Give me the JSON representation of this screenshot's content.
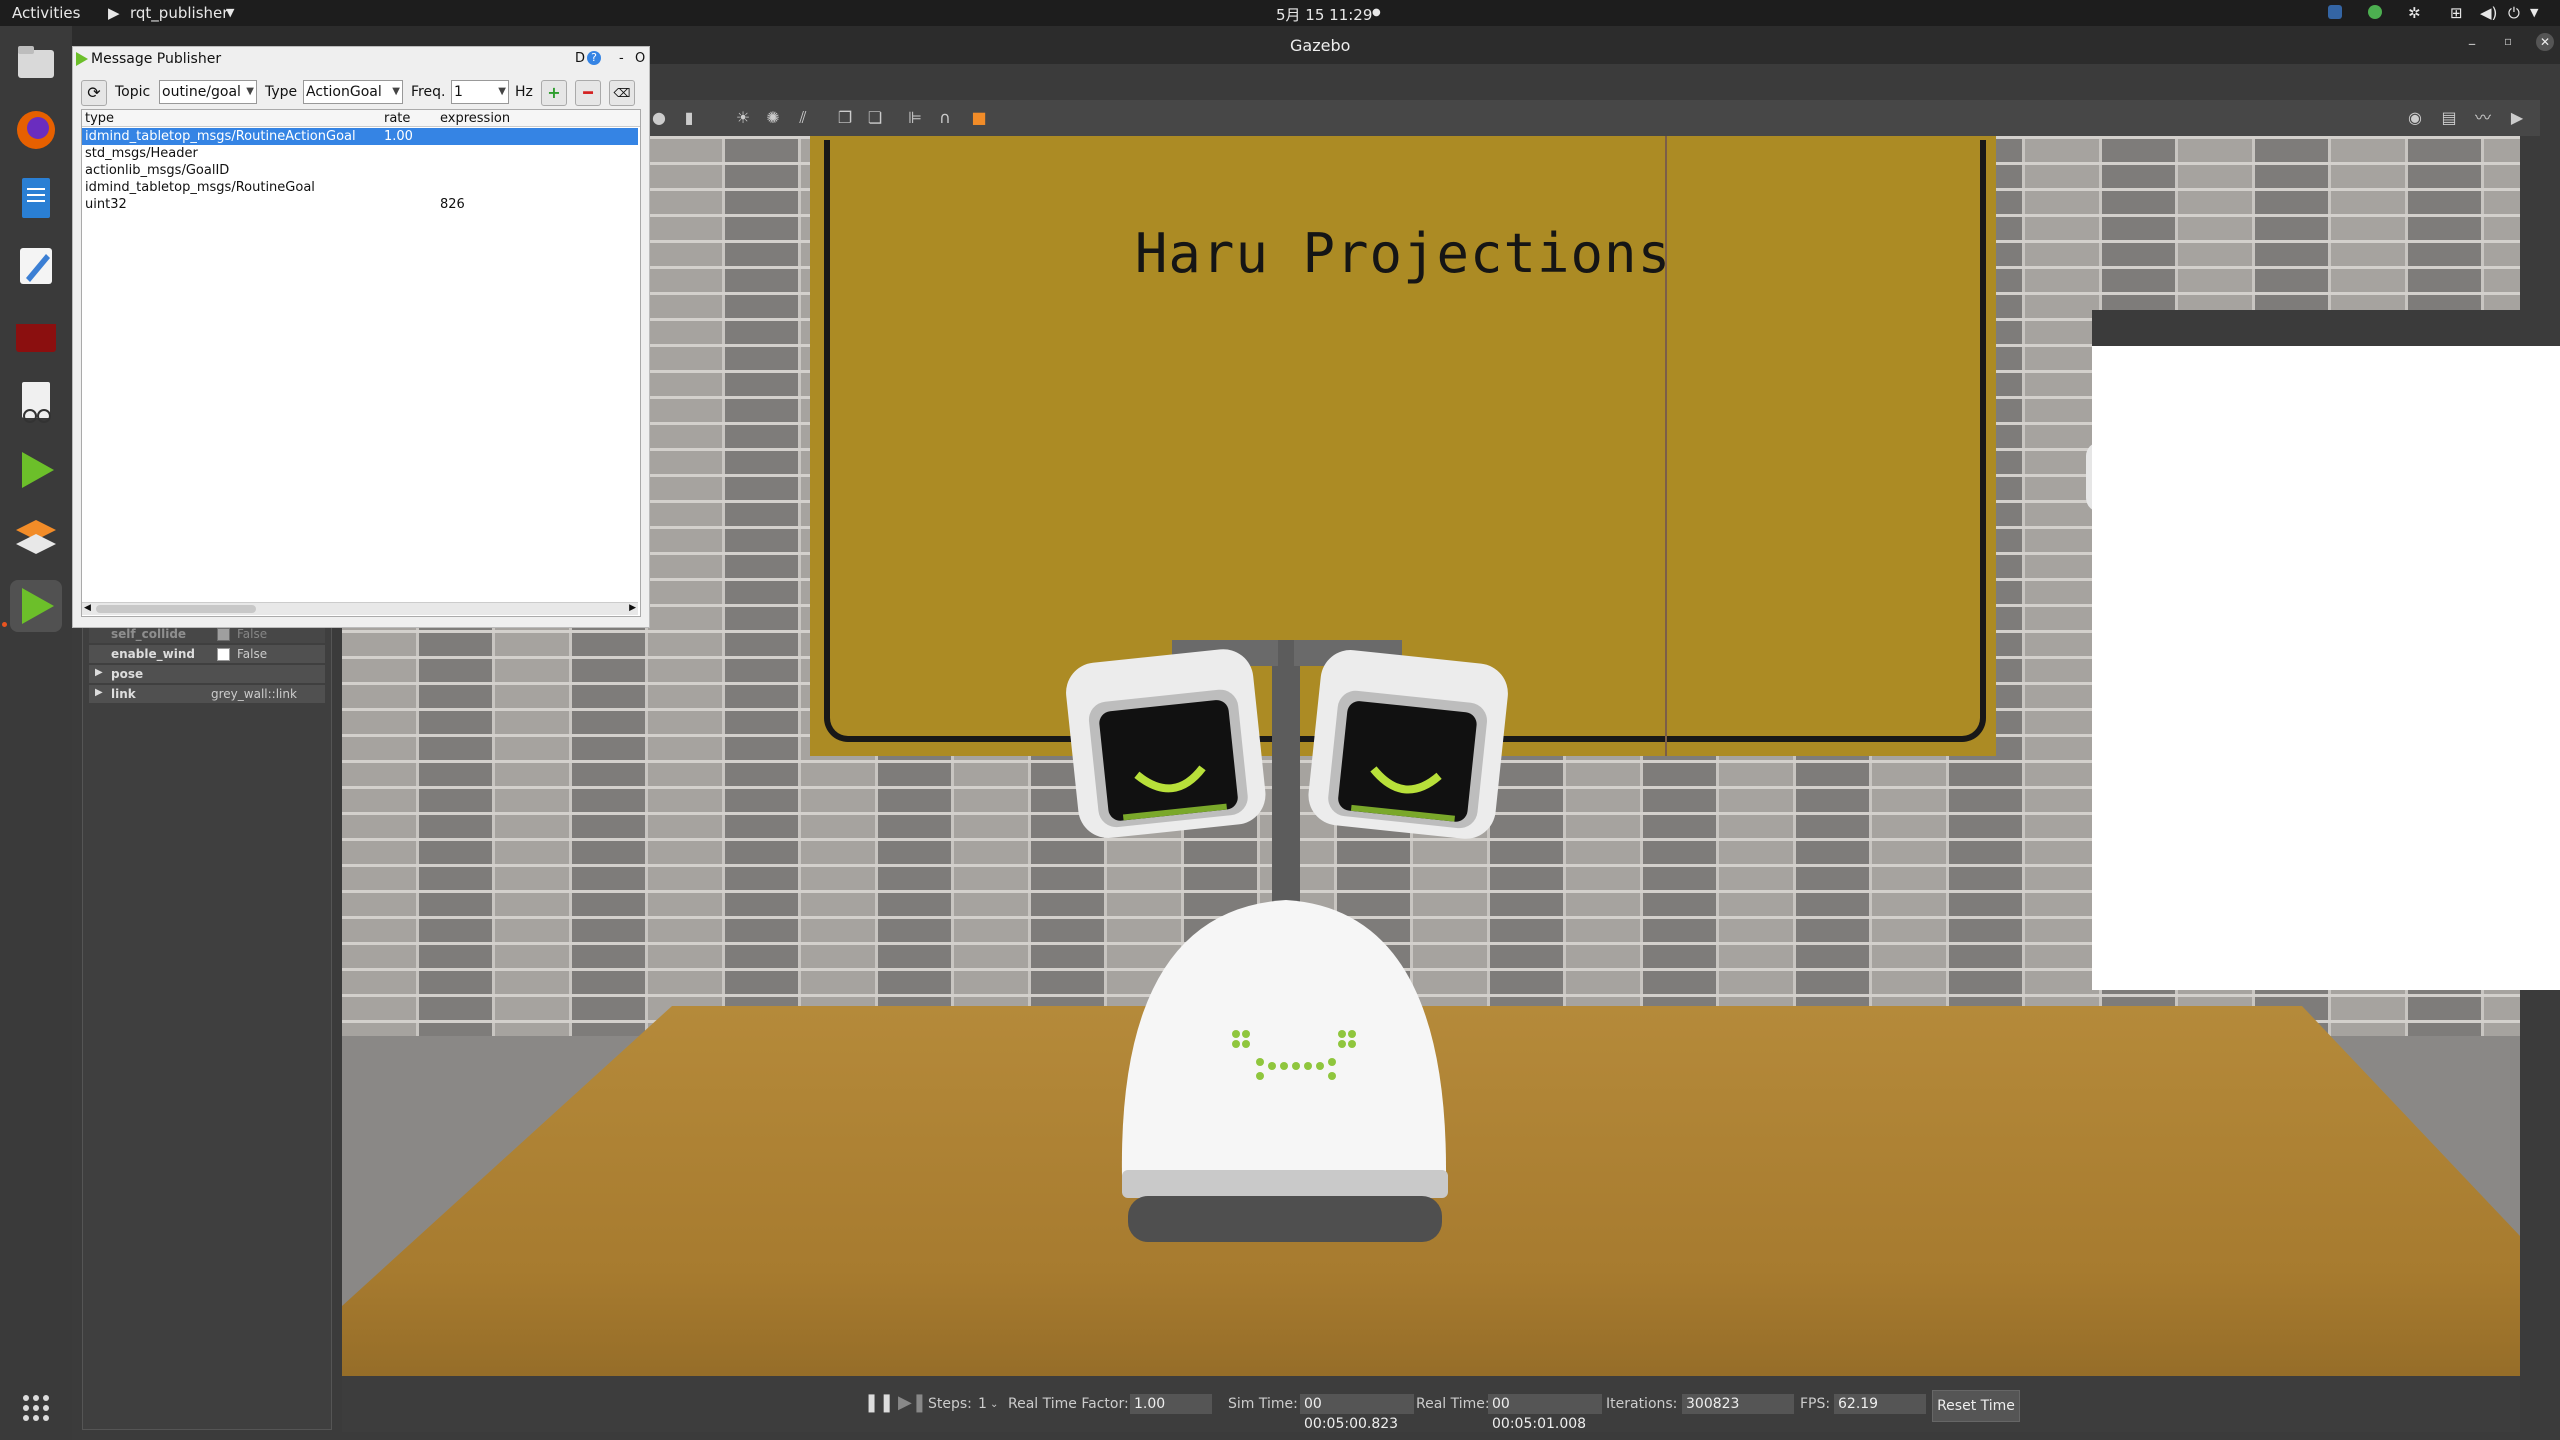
{
  "topbar": {
    "activities": "Activities",
    "app_menu": "rqt_publisher",
    "clock": "5月 15  11:29"
  },
  "gazebo": {
    "title": "Gazebo",
    "properties": [
      {
        "key": "self_collide",
        "value": "False"
      },
      {
        "key": "enable_wind",
        "value": "False"
      },
      {
        "key": "pose",
        "value": ""
      },
      {
        "key": "link",
        "value": "grey_wall::link"
      }
    ],
    "poster_text": "Haru Projections",
    "bottom": {
      "steps_label": "Steps:",
      "steps_value": "1",
      "rtf_label": "Real Time Factor:",
      "rtf_value": "1.00",
      "sim_time_label": "Sim Time:",
      "sim_time_value": "00 00:05:00.823",
      "real_time_label": "Real Time:",
      "real_time_value": "00 00:05:01.008",
      "iterations_label": "Iterations:",
      "iterations_value": "300823",
      "fps_label": "FPS:",
      "fps_value": "62.19",
      "reset_label": "Reset Time"
    }
  },
  "publisher": {
    "title": "Message Publisher",
    "topic_label": "Topic",
    "topic_value": "outine/goal",
    "type_label": "Type",
    "type_value": "ActionGoal",
    "freq_label": "Freq.",
    "freq_value": "1",
    "hz_label": "Hz",
    "headers": {
      "type": "type",
      "rate": "rate",
      "expression": "expression"
    },
    "rows": [
      {
        "type": "idmind_tabletop_msgs/RoutineActionGoal",
        "rate": "1.00",
        "expression": ""
      },
      {
        "type": "std_msgs/Header",
        "rate": "",
        "expression": ""
      },
      {
        "type": "actionlib_msgs/GoalID",
        "rate": "",
        "expression": ""
      },
      {
        "type": "idmind_tabletop_msgs/RoutineGoal",
        "rate": "",
        "expression": ""
      },
      {
        "type": "uint32",
        "rate": "",
        "expression": "826"
      }
    ]
  }
}
